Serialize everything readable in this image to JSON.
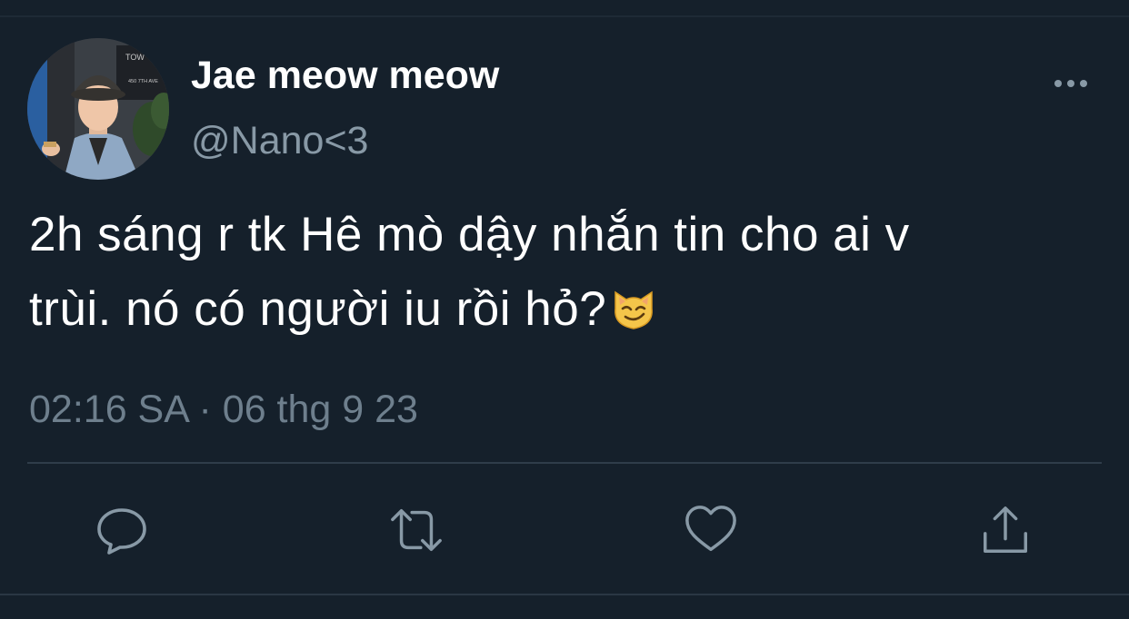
{
  "tweet": {
    "author": {
      "display_name": "Jae meow meow",
      "handle": "@Nano<3",
      "avatar_sign_text": "TOW",
      "avatar_address_text": "450 7TH AVE"
    },
    "text_line1": "2h sáng r tk Hê mò dậy nhắn tin cho ai v",
    "text_line2": "trùi. nó có người iu rồi hỏ?",
    "emoji": "smirking-cat-face",
    "time": "02:16 SA",
    "separator": "·",
    "date": "06 thg 9 23"
  },
  "actions": [
    {
      "name": "reply",
      "icon": "speech-bubble-icon"
    },
    {
      "name": "retweet",
      "icon": "retweet-arrows-icon"
    },
    {
      "name": "like",
      "icon": "heart-icon"
    },
    {
      "name": "share",
      "icon": "share-upload-icon"
    }
  ],
  "colors": {
    "background": "#15202b",
    "primary_text": "#ffffff",
    "secondary_text": "#8899a6",
    "meta_text": "#6e7f8d",
    "divider": "#2f3d4a"
  }
}
